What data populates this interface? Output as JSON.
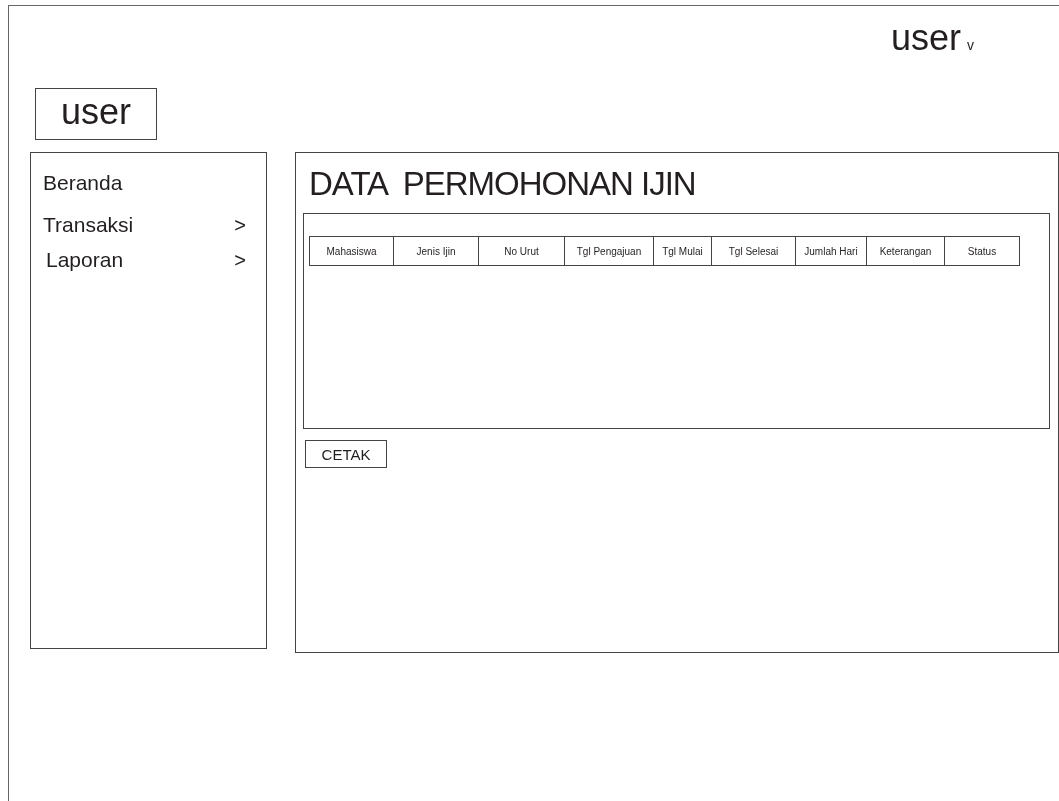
{
  "top_bar": {
    "user_menu": {
      "label": "user",
      "caret": "v"
    }
  },
  "user_box": {
    "label": "user"
  },
  "sidebar": {
    "items": [
      {
        "label": "Beranda"
      },
      {
        "label": "Transaksi",
        "arrow": ">"
      },
      {
        "label": "Laporan",
        "arrow": ">"
      }
    ]
  },
  "main": {
    "title": "DATA  PERMOHONAN IJIN",
    "table": {
      "columns": [
        "Mahasiswa",
        "Jenis Ijin",
        "No Urut",
        "Tgl Pengajuan",
        "Tgl Mulai",
        "Tgl Selesai",
        "Jumlah Hari",
        "Keterangan",
        "Status"
      ]
    },
    "buttons": [
      "CETAK"
    ]
  }
}
